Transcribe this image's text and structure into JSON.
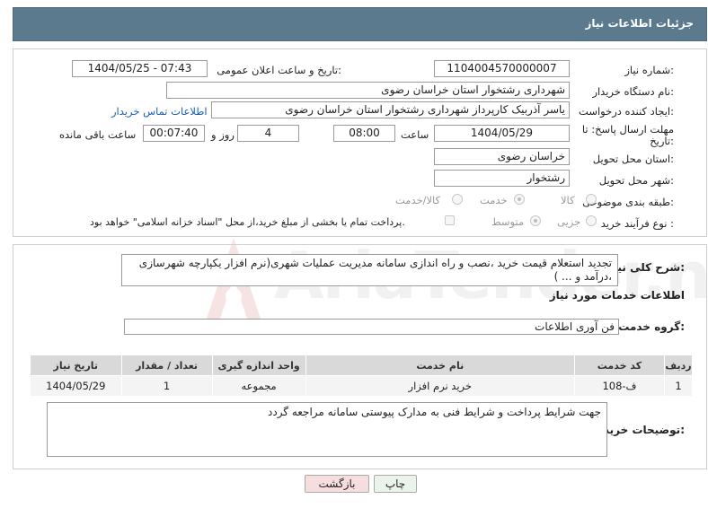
{
  "header": {
    "title": "جزئیات اطلاعات نیاز"
  },
  "form": {
    "need_number": {
      "label": "شماره نیاز:",
      "value": "1104004570000007"
    },
    "announce": {
      "label": "تاریخ و ساعت اعلان عمومی:",
      "value": "1404/05/25 - 07:43"
    },
    "buyer_org": {
      "label": "نام دستگاه خریدار:",
      "value": "شهرداری رشتخوار استان خراسان رضوی"
    },
    "requester": {
      "label": "ایجاد کننده درخواست:",
      "value": "یاسر آذربیک کارپرداز  شهرداری رشتخوار استان خراسان رضوی",
      "contact_link": "اطلاعات تماس خریدار"
    },
    "deadline": {
      "label_line1": "مهلت ارسال پاسخ: تا",
      "label_line2": "تاریخ:",
      "date": "1404/05/29",
      "time_label": "ساعت",
      "time": "08:00",
      "days": "4",
      "days_label": "روز و",
      "remaining": "00:07:40",
      "remaining_label": "ساعت باقی مانده"
    },
    "province": {
      "label": "استان محل تحویل:",
      "value": "خراسان رضوی"
    },
    "city": {
      "label": "شهر محل تحویل:",
      "value": "رشتخوار"
    },
    "category": {
      "label": "طبقه بندی موضوعی:",
      "options": [
        "کالا",
        "خدمت",
        "کالا/خدمت"
      ],
      "selected": "خدمت"
    },
    "process": {
      "label": "نوع فرآیند خرید :",
      "options": [
        "جزیی",
        "متوسط"
      ],
      "selected": "متوسط",
      "note": "پرداخت تمام یا بخشی از مبلغ خرید،از محل \"اسناد خزانه اسلامی\" خواهد بود."
    }
  },
  "summary": {
    "label": "شرح کلی نیاز:",
    "text_line1": "تجدید استعلام قیمت خرید ،نصب و راه اندازی سامانه مدیریت عملیات شهری(نرم افزار یکپارچه شهرسازی",
    "text_line2": "،درآمد و ... )"
  },
  "services": {
    "section_title": "اطلاعات خدمات مورد نیاز",
    "group_label": "گروه خدمت:",
    "group_value": "فن آوری اطلاعات",
    "columns": [
      "ردیف",
      "کد خدمت",
      "نام خدمت",
      "واحد اندازه گیری",
      "تعداد / مقدار",
      "تاریخ نیاز"
    ],
    "rows": [
      {
        "row": "1",
        "code": "ف-108",
        "name": "خرید نرم افزار",
        "unit": "مجموعه",
        "qty": "1",
        "date": "1404/05/29"
      }
    ]
  },
  "buyer_notes": {
    "label": "توضیحات خریدار:",
    "text": "جهت شرایط پرداخت و شرایط فنی به مدارک پیوستی سامانه مراجعه گردد"
  },
  "buttons": {
    "print": "چاپ",
    "back": "بازگشت"
  },
  "watermark": "AriaTender.neT",
  "colors": {
    "header_bg": "#5b7a8e",
    "link": "#1a5fb4",
    "back_btn_bg": "#f6dede",
    "print_btn_bg": "#eaf4ea"
  }
}
